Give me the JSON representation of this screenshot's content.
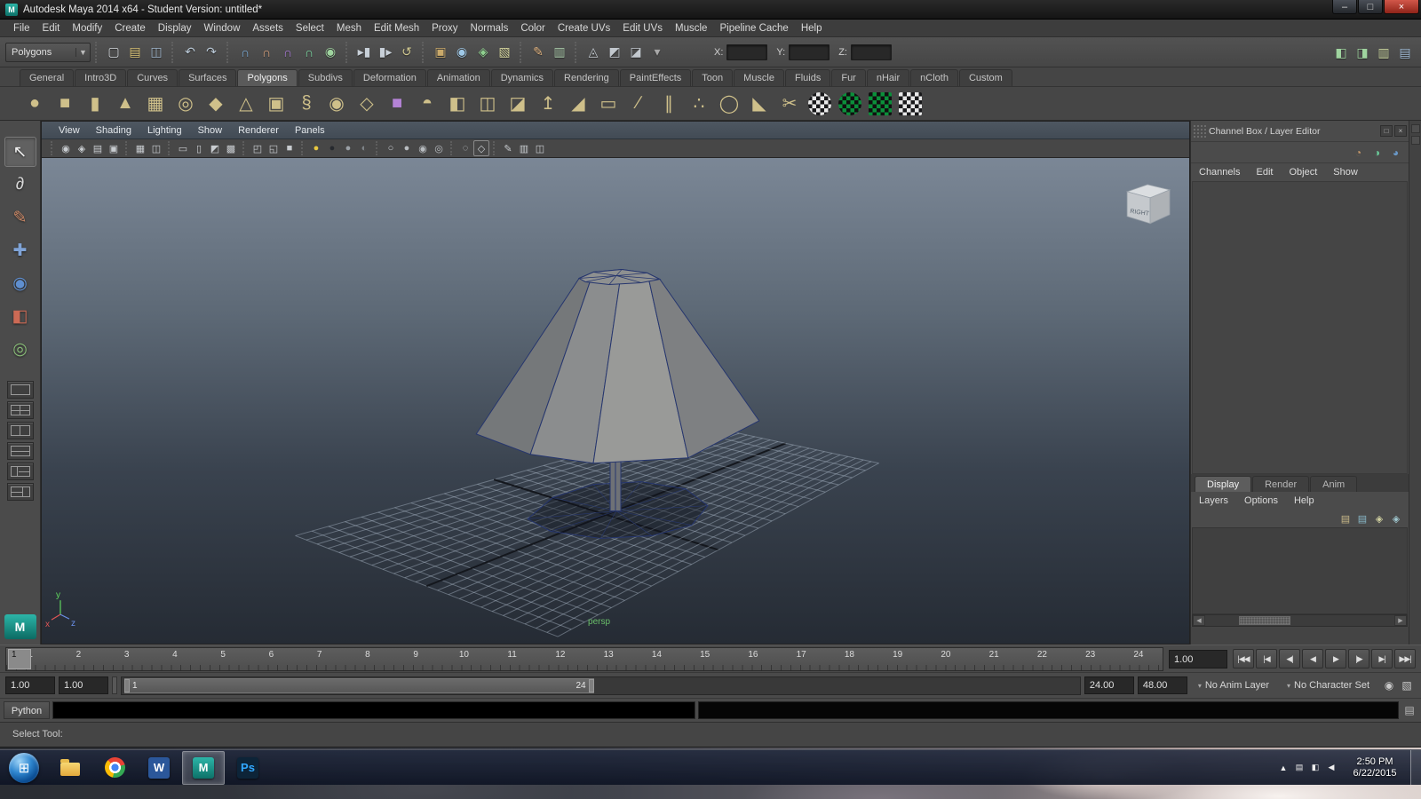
{
  "window": {
    "title": "Autodesk Maya 2014 x64 - Student Version: untitled*",
    "app_initial": "M",
    "controls": [
      {
        "name": "minimize-button",
        "glyph": "–"
      },
      {
        "name": "maximize-button",
        "glyph": "□"
      },
      {
        "name": "close-button",
        "glyph": "×"
      }
    ]
  },
  "menu_bar": {
    "items": [
      "File",
      "Edit",
      "Modify",
      "Create",
      "Display",
      "Window",
      "Assets",
      "Select",
      "Mesh",
      "Edit Mesh",
      "Proxy",
      "Normals",
      "Color",
      "Create UVs",
      "Edit UVs",
      "Muscle",
      "Pipeline Cache",
      "Help"
    ]
  },
  "status_line": {
    "mode_dropdown": "Polygons",
    "groups": [
      {
        "name": "scene-ops",
        "icons": [
          {
            "name": "new-scene-icon",
            "glyph": "▢",
            "color": "#d4d8dc"
          },
          {
            "name": "open-scene-icon",
            "glyph": "▤",
            "color": "#d8c174"
          },
          {
            "name": "save-scene-icon",
            "glyph": "◫",
            "color": "#9fb6cc"
          }
        ]
      },
      {
        "name": "undo-redo",
        "icons": [
          {
            "name": "undo-icon",
            "glyph": "↶",
            "color": "#b9c8d6"
          },
          {
            "name": "redo-icon",
            "glyph": "↷",
            "color": "#b9c8d6"
          }
        ]
      },
      {
        "name": "snapping",
        "icons": [
          {
            "name": "snap-grid-icon",
            "glyph": "∩",
            "color": "#7fb2e0"
          },
          {
            "name": "snap-curve-icon",
            "glyph": "∩",
            "color": "#e0a77f"
          },
          {
            "name": "snap-point-icon",
            "glyph": "∩",
            "color": "#b07fe0"
          },
          {
            "name": "snap-view-plane-icon",
            "glyph": "∩",
            "color": "#7fe0a7"
          },
          {
            "name": "make-live-icon",
            "glyph": "◉",
            "color": "#9fd49f"
          }
        ]
      },
      {
        "name": "history",
        "icons": [
          {
            "name": "input-to-selected-icon",
            "glyph": "▸▮",
            "color": "#c8d0d8"
          },
          {
            "name": "output-from-selected-icon",
            "glyph": "▮▸",
            "color": "#c8d0d8"
          },
          {
            "name": "construction-history-icon",
            "glyph": "↺",
            "color": "#d0c890"
          }
        ]
      },
      {
        "name": "rendering",
        "icons": [
          {
            "name": "open-render-view-icon",
            "glyph": "▣",
            "color": "#c9a96a"
          },
          {
            "name": "render-current-frame-icon",
            "glyph": "◉",
            "color": "#9fc9e8"
          },
          {
            "name": "ipr-render-icon",
            "glyph": "◈",
            "color": "#8fd08f"
          },
          {
            "name": "render-settings-icon",
            "glyph": "▧",
            "color": "#d8d8a0"
          }
        ]
      },
      {
        "name": "paint-script",
        "icons": [
          {
            "name": "paint-effects-icon",
            "glyph": "✎",
            "color": "#e0b27f"
          },
          {
            "name": "script-editor-icon",
            "glyph": "▥",
            "color": "#a8c8a8"
          }
        ]
      },
      {
        "name": "selection-masks",
        "icons": [
          {
            "name": "hierarchy-mode-icon",
            "glyph": "◬",
            "color": "#c2c8ce"
          },
          {
            "name": "object-mode-icon",
            "glyph": "◩",
            "color": "#c2c8ce"
          },
          {
            "name": "component-mode-icon",
            "glyph": "◪",
            "color": "#c2c8ce"
          },
          {
            "name": "selection-mask-menu-icon",
            "glyph": "▾",
            "color": "#a8a8a8"
          }
        ]
      }
    ],
    "coords": [
      {
        "label": "X:",
        "value": ""
      },
      {
        "label": "Y:",
        "value": ""
      },
      {
        "label": "Z:",
        "value": ""
      }
    ],
    "right_icons": [
      {
        "name": "toggle-modeling-toolkit-icon",
        "glyph": "◧",
        "color": "#9fd49f"
      },
      {
        "name": "toggle-attribute-editor-icon",
        "glyph": "◨",
        "color": "#9fd49f"
      },
      {
        "name": "toggle-tool-settings-icon",
        "glyph": "▥",
        "color": "#c9d49f"
      },
      {
        "name": "toggle-channel-box-icon",
        "glyph": "▤",
        "color": "#9fb9d4"
      }
    ]
  },
  "shelf": {
    "left_buttons": [
      {
        "name": "shelf-tab-selector-icon",
        "glyph": "▾"
      },
      {
        "name": "shelf-menu-icon",
        "glyph": "▸"
      }
    ],
    "tabs": [
      "General",
      "Intro3D",
      "Curves",
      "Surfaces",
      "Polygons",
      "Subdivs",
      "Deformation",
      "Animation",
      "Dynamics",
      "Rendering",
      "PaintEffects",
      "Toon",
      "Muscle",
      "Fluids",
      "Fur",
      "nHair",
      "nCloth",
      "Custom"
    ],
    "active_tab": "Polygons",
    "items": [
      {
        "name": "poly-sphere-icon",
        "glyph": "●",
        "color": "#cfc08a"
      },
      {
        "name": "poly-cube-icon",
        "glyph": "■",
        "color": "#cfc08a"
      },
      {
        "name": "poly-cylinder-icon",
        "glyph": "▮",
        "color": "#cfc08a"
      },
      {
        "name": "poly-cone-icon",
        "glyph": "▲",
        "color": "#cfc08a"
      },
      {
        "name": "poly-plane-icon",
        "glyph": "▦",
        "color": "#cfc08a"
      },
      {
        "name": "poly-torus-icon",
        "glyph": "◎",
        "color": "#cfc08a"
      },
      {
        "name": "poly-prism-icon",
        "glyph": "◆",
        "color": "#cfc08a"
      },
      {
        "name": "poly-pyramid-icon",
        "glyph": "△",
        "color": "#cfc08a"
      },
      {
        "name": "poly-pipe-icon",
        "glyph": "▣",
        "color": "#cfc08a"
      },
      {
        "name": "poly-helix-icon",
        "glyph": "§",
        "color": "#cfc08a"
      },
      {
        "name": "poly-soccer-ball-icon",
        "glyph": "◉",
        "color": "#cfc08a"
      },
      {
        "name": "poly-platonic-icon",
        "glyph": "◇",
        "color": "#cfc08a"
      },
      {
        "name": "interactive-creation-icon",
        "glyph": "■",
        "color": "#b483d6"
      },
      {
        "name": "sculpt-geometry-icon",
        "glyph": "◓",
        "color": "#cfc08a"
      },
      {
        "name": "mirror-geometry-icon",
        "glyph": "◧",
        "color": "#cfc08a"
      },
      {
        "name": "combine-icon",
        "glyph": "◫",
        "color": "#cfc08a"
      },
      {
        "name": "separate-icon",
        "glyph": "◪",
        "color": "#cfc08a"
      },
      {
        "name": "extrude-icon",
        "glyph": "↥",
        "color": "#cfc08a"
      },
      {
        "name": "bevel-icon",
        "glyph": "◢",
        "color": "#cfc08a"
      },
      {
        "name": "bridge-icon",
        "glyph": "▭",
        "color": "#cfc08a"
      },
      {
        "name": "split-polygon-icon",
        "glyph": "∕",
        "color": "#cfc08a"
      },
      {
        "name": "insert-edge-loop-icon",
        "glyph": "∥",
        "color": "#cfc08a"
      },
      {
        "name": "merge-vertices-icon",
        "glyph": "∴",
        "color": "#cfc08a"
      },
      {
        "name": "smooth-icon",
        "glyph": "◯",
        "color": "#cfc08a"
      },
      {
        "name": "crease-tool-icon",
        "glyph": "◣",
        "color": "#cfc08a"
      },
      {
        "name": "multi-cut-icon",
        "glyph": "✂",
        "color": "#cfc08a"
      },
      {
        "name": "smooth-mesh-preview-icon",
        "checker": true
      },
      {
        "name": "uv-texture-checker-icon",
        "checker": true,
        "green": true
      },
      {
        "name": "uv-editor-icon",
        "checker": true,
        "square": true,
        "green": true
      },
      {
        "name": "uv-snapshot-icon",
        "checker": true,
        "square": true
      }
    ]
  },
  "toolbox": {
    "tools": [
      {
        "name": "select-tool",
        "glyph": "↖",
        "color": "#eeeeee",
        "active": true
      },
      {
        "name": "lasso-select-tool",
        "glyph": "∂",
        "color": "#d8d8d8"
      },
      {
        "name": "paint-select-tool",
        "glyph": "✎",
        "color": "#cc8866"
      },
      {
        "name": "move-tool",
        "glyph": "✚",
        "color": "#7fa3d6"
      },
      {
        "name": "rotate-tool",
        "glyph": "◉",
        "color": "#5f8fd0"
      },
      {
        "name": "scale-tool",
        "glyph": "◧",
        "color": "#cc6a55"
      },
      {
        "name": "universal-manipulator-tool",
        "glyph": "◎",
        "color": "#88bb77"
      }
    ],
    "layouts": [
      {
        "name": "layout-single-pane"
      },
      {
        "name": "layout-four-pane"
      },
      {
        "name": "layout-two-pane-side-by-side"
      },
      {
        "name": "layout-two-pane-stacked"
      },
      {
        "name": "layout-three-pane-split-right"
      },
      {
        "name": "layout-three-pane-split-left"
      }
    ]
  },
  "panel": {
    "menus": [
      "View",
      "Shading",
      "Lighting",
      "Show",
      "Renderer",
      "Panels"
    ],
    "toolbar": [
      [
        {
          "name": "select-camera-icon",
          "glyph": "◉",
          "color": "#c8ccd0"
        },
        {
          "name": "lock-camera-icon",
          "glyph": "◈",
          "color": "#c8ccd0"
        },
        {
          "name": "camera-attributes-icon",
          "glyph": "▤",
          "color": "#c8ccd0"
        },
        {
          "name": "bookmarks-icon",
          "glyph": "▣",
          "color": "#c8ccd0"
        }
      ],
      [
        {
          "name": "image-plane-icon",
          "glyph": "▦",
          "color": "#c8ccd0"
        },
        {
          "name": "2d-pan-zoom-icon",
          "glyph": "◫",
          "color": "#c8ccd0"
        }
      ],
      [
        {
          "name": "film-gate-icon",
          "glyph": "▭",
          "color": "#c8ccd0"
        },
        {
          "name": "resolution-gate-icon",
          "glyph": "▯",
          "color": "#c8ccd0"
        },
        {
          "name": "gate-mask-icon",
          "glyph": "◩",
          "color": "#c8ccd0"
        },
        {
          "name": "field-chart-icon",
          "glyph": "▩",
          "color": "#c8ccd0"
        }
      ],
      [
        {
          "name": "safe-action-icon",
          "glyph": "◰",
          "color": "#c8ccd0"
        },
        {
          "name": "safe-title-icon",
          "glyph": "◱",
          "color": "#c8ccd0"
        },
        {
          "name": "fill-mode-icon",
          "glyph": "■",
          "color": "#c8ccd0"
        }
      ],
      [
        {
          "name": "default-lighting-icon",
          "glyph": "●",
          "color": "#e8c840"
        },
        {
          "name": "all-lights-icon",
          "glyph": "●",
          "color": "#26292e"
        },
        {
          "name": "no-lights-icon",
          "glyph": "●",
          "color": "#9aa0a6"
        },
        {
          "name": "shadows-icon",
          "glyph": "◐",
          "color": "#7f8489"
        }
      ],
      [
        {
          "name": "wireframe-mode-icon",
          "glyph": "○",
          "color": "#c8ccd0"
        },
        {
          "name": "smooth-shade-icon",
          "glyph": "●",
          "color": "#b8bcc0"
        },
        {
          "name": "textured-mode-icon",
          "glyph": "◉",
          "color": "#b8bcc0"
        },
        {
          "name": "use-all-lights-icon",
          "glyph": "◎",
          "color": "#b8bcc0"
        }
      ],
      [
        {
          "name": "xray-icon",
          "glyph": "◌",
          "color": "#c8ccd0"
        },
        {
          "name": "isolate-select-icon",
          "glyph": "◇",
          "color": "#c8ccd0",
          "outlined": true
        }
      ],
      [
        {
          "name": "grease-pencil-icon",
          "glyph": "✎",
          "color": "#c8ccd0"
        },
        {
          "name": "camera-snapshot-icon",
          "glyph": "▥",
          "color": "#c8ccd0"
        },
        {
          "name": "multi-view-icon",
          "glyph": "◫",
          "color": "#c8ccd0"
        }
      ]
    ],
    "viewcube_label": "RIGHT",
    "axis_labels": {
      "x": "x",
      "y": "y",
      "z": "z"
    },
    "camera_label": "persp"
  },
  "channel_box": {
    "header": "Channel Box / Layer Editor",
    "top_icons": [
      {
        "name": "dock-panel-icon",
        "glyph": "□"
      },
      {
        "name": "close-panel-icon",
        "glyph": "×"
      }
    ],
    "option_icons": [
      {
        "name": "channel-slider-speed-icon",
        "glyph": "◔",
        "color": "#c9996a"
      },
      {
        "name": "channel-slider-medium-icon",
        "glyph": "◑",
        "color": "#6ac999"
      },
      {
        "name": "channel-slider-hyperbolic-icon",
        "glyph": "◕",
        "color": "#6a99c9"
      }
    ],
    "menus": [
      "Channels",
      "Edit",
      "Object",
      "Show"
    ],
    "layer_tabs": [
      {
        "label": "Display",
        "active": true
      },
      {
        "label": "Render",
        "active": false
      },
      {
        "label": "Anim",
        "active": false
      }
    ],
    "layer_menus": [
      "Layers",
      "Options",
      "Help"
    ],
    "layer_icons": [
      {
        "name": "move-layer-up-icon",
        "glyph": "▤",
        "color": "#c8b888"
      },
      {
        "name": "move-layer-down-icon",
        "glyph": "▤",
        "color": "#88b8c8"
      },
      {
        "name": "new-empty-layer-icon",
        "glyph": "◈",
        "color": "#d0d0a0"
      },
      {
        "name": "new-layer-from-selected-icon",
        "glyph": "◈",
        "color": "#a0c8d0"
      }
    ]
  },
  "time_slider": {
    "frame_numbers": [
      "1",
      "2",
      "3",
      "4",
      "5",
      "6",
      "7",
      "8",
      "9",
      "10",
      "11",
      "12",
      "13",
      "14",
      "15",
      "16",
      "17",
      "18",
      "19",
      "20",
      "21",
      "22",
      "23",
      "24"
    ],
    "current_frame": "1",
    "current_time": "1.00",
    "playback_buttons": [
      {
        "name": "go-to-start-button",
        "glyph": "|◀◀"
      },
      {
        "name": "step-back-frame-button",
        "glyph": "|◀"
      },
      {
        "name": "step-back-key-button",
        "glyph": "◀|"
      },
      {
        "name": "play-backwards-button",
        "glyph": "◀"
      },
      {
        "name": "play-forwards-button",
        "glyph": "▶"
      },
      {
        "name": "step-forward-key-button",
        "glyph": "|▶"
      },
      {
        "name": "step-forward-frame-button",
        "glyph": "▶|"
      },
      {
        "name": "go-to-end-button",
        "glyph": "▶▶|"
      }
    ]
  },
  "range_slider": {
    "animation_start": "1.00",
    "playback_start": "1.00",
    "range_start": "1",
    "range_end": "24",
    "playback_end": "24.00",
    "animation_end": "48.00",
    "anim_layer": "No Anim Layer",
    "character_set": "No Character Set",
    "icons": [
      {
        "name": "auto-keyframe-icon",
        "glyph": "◉"
      },
      {
        "name": "animation-preferences-icon",
        "glyph": "▧"
      }
    ]
  },
  "command_line": {
    "label": "Python",
    "input": "",
    "result": ""
  },
  "help_line": {
    "text": "Select Tool:"
  },
  "taskbar": {
    "apps": [
      {
        "name": "start-button",
        "type": "start"
      },
      {
        "name": "explorer-app",
        "type": "folder"
      },
      {
        "name": "chrome-app",
        "type": "chrome"
      },
      {
        "name": "word-app",
        "type": "tile",
        "label": "W",
        "bg": "#2b579a",
        "color": "#ffffff"
      },
      {
        "name": "maya-app",
        "type": "tile",
        "label": "M",
        "bg": "linear-gradient(#2cb5a8,#0d7168)",
        "color": "#ffffff",
        "active": true
      },
      {
        "name": "photoshop-app",
        "type": "tile",
        "label": "Ps",
        "bg": "#0d2438",
        "color": "#31a8ff"
      }
    ],
    "tray_icons": [
      {
        "name": "hidden-icons-icon",
        "glyph": "▲"
      },
      {
        "name": "action-center-icon",
        "glyph": "▤"
      },
      {
        "name": "network-icon",
        "glyph": "◧"
      },
      {
        "name": "volume-icon",
        "glyph": "◀"
      }
    ],
    "tray_time": "2:50 PM",
    "tray_date": "6/22/2015"
  }
}
